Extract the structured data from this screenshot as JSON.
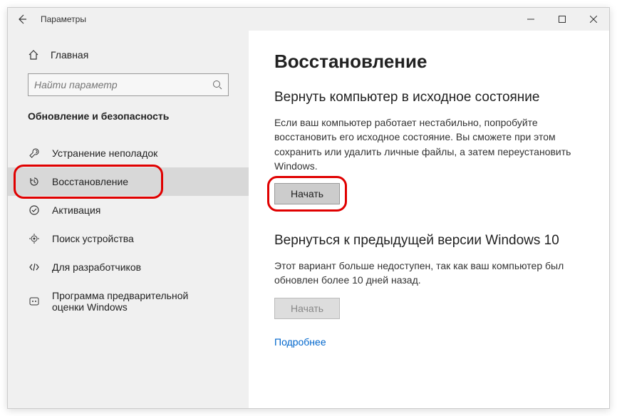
{
  "window": {
    "title": "Параметры"
  },
  "sidebar": {
    "home": "Главная",
    "search_placeholder": "Найти параметр",
    "section": "Обновление и безопасность",
    "items": [
      {
        "label": "Устранение неполадок"
      },
      {
        "label": "Восстановление"
      },
      {
        "label": "Активация"
      },
      {
        "label": "Поиск устройства"
      },
      {
        "label": "Для разработчиков"
      },
      {
        "label": "Программа предварительной оценки Windows"
      }
    ]
  },
  "main": {
    "title": "Восстановление",
    "reset": {
      "heading": "Вернуть компьютер в исходное состояние",
      "text": "Если ваш компьютер работает нестабильно, попробуйте восстановить его исходное состояние. Вы сможете при этом сохранить или удалить личные файлы, а затем переустановить Windows.",
      "button": "Начать"
    },
    "rollback": {
      "heading": "Вернуться к предыдущей версии Windows 10",
      "text": "Этот вариант больше недоступен, так как ваш компьютер был обновлен более 10 дней назад.",
      "button": "Начать",
      "link": "Подробнее"
    }
  }
}
